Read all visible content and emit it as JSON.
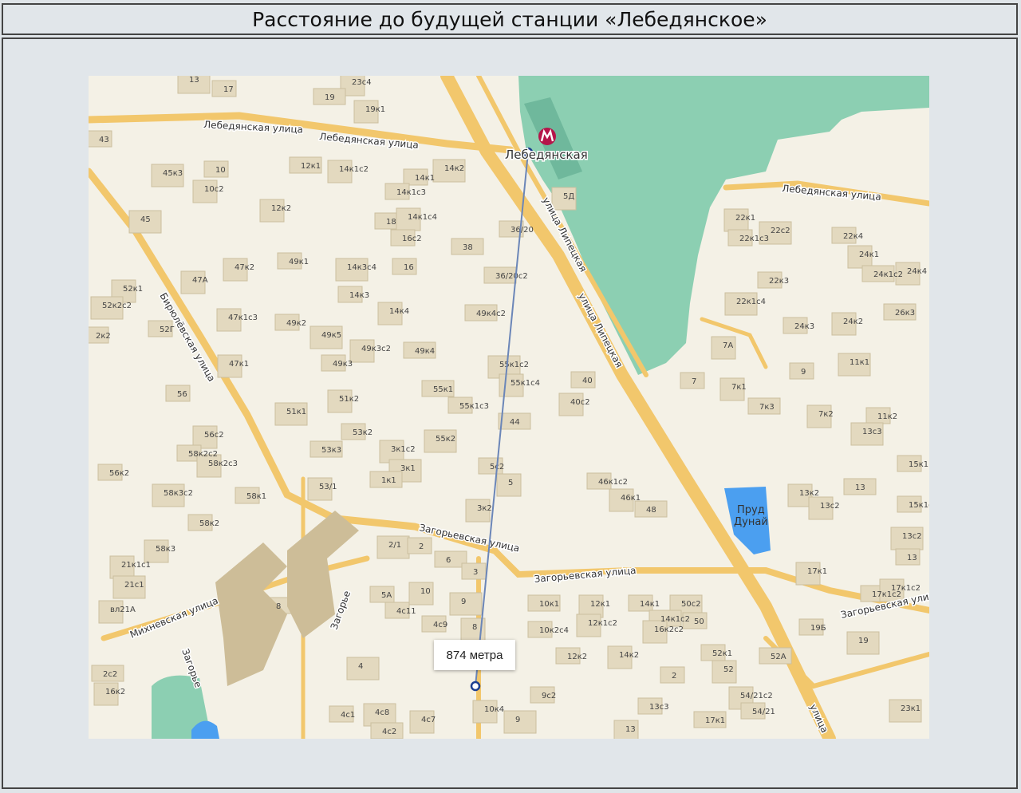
{
  "title": "Расстояние до будущей станции «Лебедянское»",
  "map": {
    "station": {
      "name": "Лебедянская",
      "icon": "metro-icon",
      "color": "#b5154a"
    },
    "distance_label": "874 метра",
    "route_color": "#6b86b8",
    "colors": {
      "background": "#f4f1e6",
      "water": "#8ccfb2",
      "road": "#f2c76c",
      "building": "#e3d9bf",
      "pond": "#4b9ff0"
    },
    "streets": [
      "Лебедянская улица",
      "Лебедянская улица",
      "Лебедянская улица",
      "улица Липецкая",
      "улица Липецкая",
      "Бирюлёвская улица",
      "Загорьевская улица",
      "Загорьевская улица",
      "Загорьевская улица",
      "Михневская улица",
      "Загорье",
      "Загорье",
      "улица"
    ],
    "pond_label": [
      "Пруд",
      "Дунай"
    ],
    "buildings": [
      "13",
      "17",
      "23с4",
      "19",
      "19к1",
      "43",
      "45к3",
      "10",
      "10с2",
      "12к1",
      "14к1с2",
      "14к1",
      "14к2",
      "14к1с3",
      "12к2",
      "18",
      "14к1с4",
      "16с2",
      "45",
      "36/20",
      "5Д",
      "38",
      "47к2",
      "49к1",
      "14к3с4",
      "16",
      "47А",
      "36/20с2",
      "52к1",
      "14к3",
      "52к2с2",
      "52Г",
      "14к4",
      "49к4с2",
      "47к1с3",
      "49к2",
      "49к5",
      "2к2",
      "49к3с2",
      "49к4",
      "47к1",
      "49к3",
      "55к1с2",
      "40",
      "55к1с4",
      "55к1",
      "51к2",
      "56",
      "51к1",
      "55к1с3",
      "40с2",
      "44",
      "56с2",
      "53к2",
      "55к2",
      "58к2с2",
      "58к2с3",
      "53к3",
      "3к1с2",
      "56к2",
      "3к1",
      "5с2",
      "53/1",
      "1к1",
      "5",
      "46к1с2",
      "58к3с2",
      "58к1",
      "46к1",
      "48",
      "3к2",
      "58к2",
      "2/1",
      "2",
      "58к3",
      "6",
      "21к1с1",
      "3",
      "21с1",
      "5А",
      "10",
      "8",
      "вл21А",
      "4с11",
      "9",
      "4с9",
      "8",
      "10к1",
      "12к1",
      "14к1",
      "50с2",
      "10к2с4",
      "12к1с2",
      "14к1с2",
      "16к2с2",
      "50",
      "4",
      "12к2",
      "14к2",
      "2с2",
      "16к2",
      "2",
      "4с8",
      "4с1",
      "4с7",
      "4с2",
      "10к4",
      "9с2",
      "9",
      "13с3",
      "13",
      "17к1",
      "22к1",
      "22к1с3",
      "22с2",
      "22к4",
      "24к1",
      "24к1с2",
      "24к4",
      "22к3",
      "22к1с4",
      "24к3",
      "24к2",
      "26к3",
      "7А",
      "9",
      "11к1",
      "7",
      "7к1",
      "7к3",
      "7к2",
      "11к2",
      "13с3",
      "15к1",
      "13к2",
      "13",
      "13с2",
      "15к1с2",
      "13с2",
      "13",
      "17к1",
      "17к1с2",
      "17к1с2",
      "19Б",
      "19",
      "52к1",
      "52",
      "52А",
      "54/21с2",
      "54/21",
      "23к1"
    ]
  }
}
